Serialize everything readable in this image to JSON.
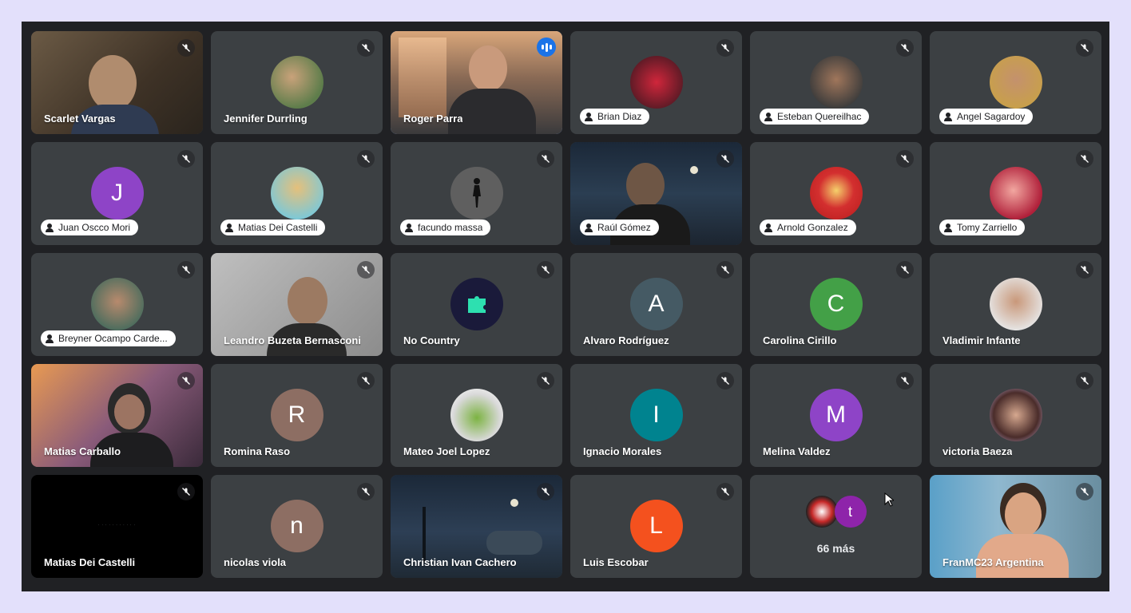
{
  "meeting": {
    "more": {
      "label": "66 más",
      "avatar_letter": "t"
    },
    "tiles": [
      {
        "id": "t1",
        "name": "Scarlet Vargas",
        "style": "name",
        "muted": true
      },
      {
        "id": "t2",
        "name": "Jennifer Durrling",
        "style": "name",
        "muted": true
      },
      {
        "id": "t3",
        "name": "Roger Parra",
        "style": "name",
        "speaking": true
      },
      {
        "id": "t4",
        "name": "Brian Diaz",
        "style": "pill",
        "muted": true
      },
      {
        "id": "t5",
        "name": "Esteban Quereilhac",
        "style": "pill",
        "muted": true
      },
      {
        "id": "t6",
        "name": "Angel Sagardoy",
        "style": "pill",
        "muted": true
      },
      {
        "id": "t7",
        "name": "Juan Oscco Mori",
        "style": "pill",
        "muted": true,
        "letter": "J",
        "color": "#8e44c7"
      },
      {
        "id": "t8",
        "name": "Matias Dei Castelli",
        "style": "pill",
        "muted": true
      },
      {
        "id": "t9",
        "name": "facundo massa",
        "style": "pill",
        "muted": true
      },
      {
        "id": "t10",
        "name": "Raúl Gómez",
        "style": "pill",
        "muted": true
      },
      {
        "id": "t11",
        "name": "Arnold Gonzalez",
        "style": "pill",
        "muted": true
      },
      {
        "id": "t12",
        "name": "Tomy Zarriello",
        "style": "pill",
        "muted": true
      },
      {
        "id": "t13",
        "name": "Breyner Ocampo Carde...",
        "style": "pill",
        "muted": true
      },
      {
        "id": "t14",
        "name": "Leandro Buzeta Bernasconi",
        "style": "name",
        "muted": true
      },
      {
        "id": "t15",
        "name": "No Country",
        "style": "name",
        "muted": true
      },
      {
        "id": "t16",
        "name": "Alvaro Rodríguez",
        "style": "name",
        "muted": true,
        "letter": "A",
        "color": "#455a64"
      },
      {
        "id": "t17",
        "name": "Carolina Cirillo",
        "style": "name",
        "muted": true,
        "letter": "C",
        "color": "#43a047"
      },
      {
        "id": "t18",
        "name": "Vladimir Infante",
        "style": "name",
        "muted": true
      },
      {
        "id": "t19",
        "name": "Matias Carballo",
        "style": "name",
        "muted": true
      },
      {
        "id": "t20",
        "name": "Romina Raso",
        "style": "name",
        "muted": true,
        "letter": "R",
        "color": "#8d6e63"
      },
      {
        "id": "t21",
        "name": "Mateo Joel Lopez",
        "style": "name",
        "muted": true
      },
      {
        "id": "t22",
        "name": "Ignacio Morales",
        "style": "name",
        "muted": true,
        "letter": "I",
        "color": "#00838f"
      },
      {
        "id": "t23",
        "name": "Melina Valdez",
        "style": "name",
        "muted": true,
        "letter": "M",
        "color": "#8e44c7"
      },
      {
        "id": "t24",
        "name": "victoria Baeza",
        "style": "name",
        "muted": true
      },
      {
        "id": "t25",
        "name": "Matias Dei Castelli",
        "style": "name",
        "muted": true
      },
      {
        "id": "t26",
        "name": "nicolas viola",
        "style": "name",
        "muted": true,
        "letter": "n",
        "color": "#8d6e63"
      },
      {
        "id": "t27",
        "name": "Christian Ivan Cachero",
        "style": "name",
        "muted": true
      },
      {
        "id": "t28",
        "name": "Luis Escobar",
        "style": "name",
        "muted": true,
        "letter": "L",
        "color": "#f4511e"
      },
      {
        "id": "t29",
        "style": "more"
      },
      {
        "id": "t30",
        "name": "FranMC23 Argentina",
        "style": "name",
        "muted": true
      }
    ]
  }
}
